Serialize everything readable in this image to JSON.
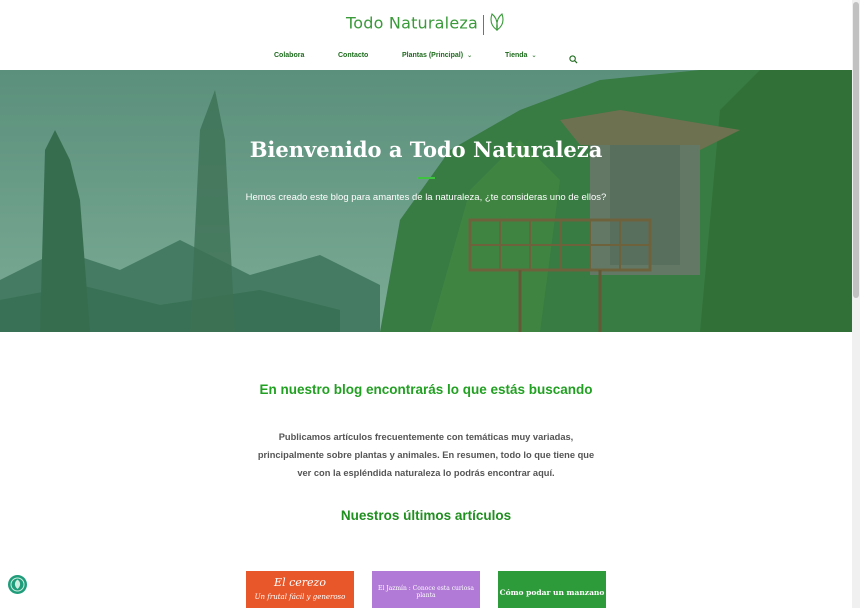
{
  "header": {
    "logo_text": "Todo Naturaleza",
    "nav": [
      {
        "label": "Colabora",
        "dropdown": false
      },
      {
        "label": "Contacto",
        "dropdown": false
      },
      {
        "label": "Plantas (Principal)",
        "dropdown": true
      },
      {
        "label": "Tienda",
        "dropdown": true
      }
    ],
    "search_icon": "search-icon"
  },
  "hero": {
    "title": "Bienvenido a Todo Naturaleza",
    "subtitle": "Hemos creado este blog para amantes de la naturaleza, ¿te consideras uno de ellos?"
  },
  "intro": {
    "heading": "En nuestro blog encontrarás lo que estás buscando",
    "paragraph": "Publicamos artículos frecuentemente con temáticas muy variadas, principalmente sobre plantas y animales. En resumen, todo lo que tiene que ver con la espléndida naturaleza lo podrás encontrar aquí."
  },
  "latest": {
    "heading": "Nuestros últimos artículos",
    "cards": [
      {
        "title": "El cerezo",
        "subtitle": "Un frutal fácil y generoso"
      },
      {
        "title": "El Jazmín : Conoce esta curiosa planta"
      },
      {
        "title": "Cómo podar un manzano"
      }
    ]
  },
  "colors": {
    "brand_green": "#3a9a3a",
    "heading_green": "#22a022",
    "nav_green": "#1e6b1e"
  }
}
